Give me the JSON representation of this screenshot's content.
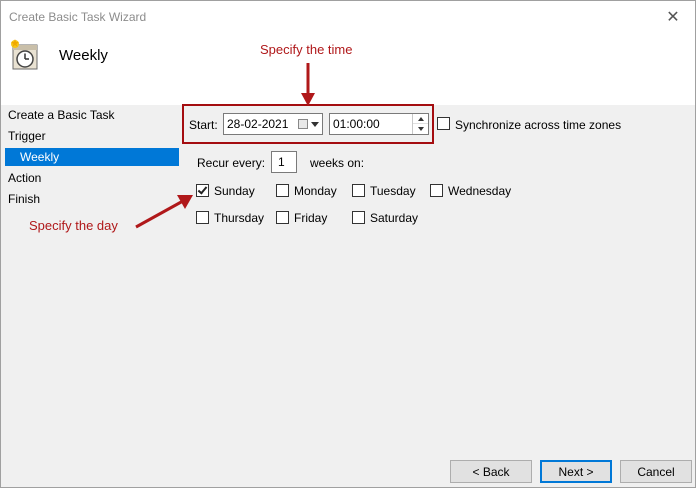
{
  "window": {
    "title": "Create Basic Task Wizard",
    "close_glyph": "✕"
  },
  "header": {
    "title": "Weekly",
    "icon": "clock-calendar-icon"
  },
  "sidebar": {
    "items": [
      {
        "label": "Create a Basic Task",
        "selected": false
      },
      {
        "label": "Trigger",
        "selected": false
      },
      {
        "label": "Weekly",
        "selected": true
      },
      {
        "label": "Action",
        "selected": false
      },
      {
        "label": "Finish",
        "selected": false
      }
    ]
  },
  "form": {
    "start_label": "Start:",
    "start_date": "28-02-2021",
    "start_time": "01:00:00",
    "sync_label": "Synchronize across time zones",
    "sync_checked": false,
    "recur_label": "Recur every:",
    "recur_value": "1",
    "recur_suffix": "weeks on:",
    "days": [
      {
        "label": "Sunday",
        "checked": true
      },
      {
        "label": "Monday",
        "checked": false
      },
      {
        "label": "Tuesday",
        "checked": false
      },
      {
        "label": "Wednesday",
        "checked": false
      },
      {
        "label": "Thursday",
        "checked": false
      },
      {
        "label": "Friday",
        "checked": false
      },
      {
        "label": "Saturday",
        "checked": false
      }
    ]
  },
  "annotations": {
    "time": "Specify the time",
    "day": "Specify the day",
    "color": "#b0181a"
  },
  "buttons": {
    "back": "< Back",
    "next": "Next >",
    "cancel": "Cancel"
  },
  "colors": {
    "accent": "#0078d7",
    "highlight_box": "#a40d10"
  }
}
